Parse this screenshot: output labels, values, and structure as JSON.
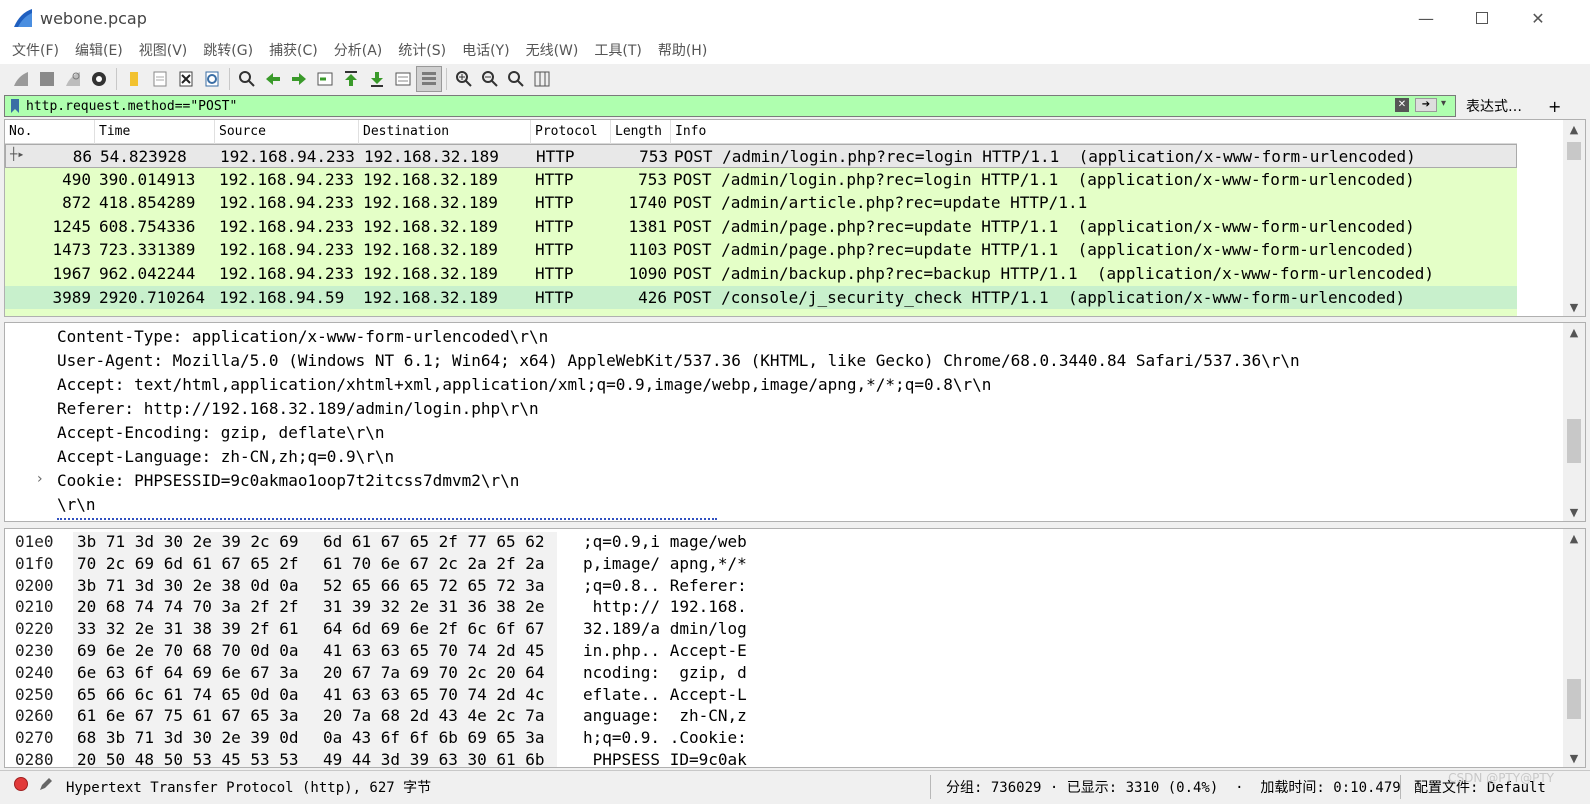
{
  "window": {
    "title": "webone.pcap"
  },
  "menu": [
    "文件(F)",
    "编辑(E)",
    "视图(V)",
    "跳转(G)",
    "捕获(C)",
    "分析(A)",
    "统计(S)",
    "电话(Y)",
    "无线(W)",
    "工具(T)",
    "帮助(H)"
  ],
  "filter": {
    "value": "http.request.method==\"POST\"",
    "expression_label": "表达式…",
    "add_label": "+"
  },
  "packet_list": {
    "columns": [
      "No.",
      "Time",
      "Source",
      "Destination",
      "Protocol",
      "Length",
      "Info"
    ],
    "rows": [
      {
        "no": "86",
        "time": "54.823928",
        "src": "192.168.94.233",
        "dst": "192.168.32.189",
        "proto": "HTTP",
        "len": "753",
        "info": "POST /admin/login.php?rec=login HTTP/1.1  (application/x-www-form-urlencoded)"
      },
      {
        "no": "490",
        "time": "390.014913",
        "src": "192.168.94.233",
        "dst": "192.168.32.189",
        "proto": "HTTP",
        "len": "753",
        "info": "POST /admin/login.php?rec=login HTTP/1.1  (application/x-www-form-urlencoded)"
      },
      {
        "no": "872",
        "time": "418.854289",
        "src": "192.168.94.233",
        "dst": "192.168.32.189",
        "proto": "HTTP",
        "len": "1740",
        "info": "POST /admin/article.php?rec=update HTTP/1.1"
      },
      {
        "no": "1245",
        "time": "608.754336",
        "src": "192.168.94.233",
        "dst": "192.168.32.189",
        "proto": "HTTP",
        "len": "1381",
        "info": "POST /admin/page.php?rec=update HTTP/1.1  (application/x-www-form-urlencoded)"
      },
      {
        "no": "1473",
        "time": "723.331389",
        "src": "192.168.94.233",
        "dst": "192.168.32.189",
        "proto": "HTTP",
        "len": "1103",
        "info": "POST /admin/page.php?rec=update HTTP/1.1  (application/x-www-form-urlencoded)"
      },
      {
        "no": "1967",
        "time": "962.042244",
        "src": "192.168.94.233",
        "dst": "192.168.32.189",
        "proto": "HTTP",
        "len": "1090",
        "info": "POST /admin/backup.php?rec=backup HTTP/1.1  (application/x-www-form-urlencoded)"
      },
      {
        "no": "3989",
        "time": "2920.710264",
        "src": "192.168.94.59",
        "dst": "192.168.32.189",
        "proto": "HTTP",
        "len": "426",
        "info": "POST /console/j_security_check HTTP/1.1  (application/x-www-form-urlencoded)"
      }
    ]
  },
  "details": [
    "Content-Type: application/x-www-form-urlencoded\\r\\n",
    "User-Agent: Mozilla/5.0 (Windows NT 6.1; Win64; x64) AppleWebKit/537.36 (KHTML, like Gecko) Chrome/68.0.3440.84 Safari/537.36\\r\\n",
    "Accept: text/html,application/xhtml+xml,application/xml;q=0.9,image/webp,image/apng,*/*;q=0.8\\r\\n",
    "Referer: http://192.168.32.189/admin/login.php\\r\\n",
    "Accept-Encoding: gzip, deflate\\r\\n",
    "Accept-Language: zh-CN,zh;q=0.9\\r\\n",
    "Cookie: PHPSESSID=9c0akmao1oop7t2itcss7dmvm2\\r\\n",
    "\\r\\n"
  ],
  "bytes": [
    {
      "off": "01e0",
      "h1": "3b 71 3d 30 2e 39 2c 69",
      "h2": "6d 61 67 65 2f 77 65 62",
      "a": ";q=0.9,i mage/web"
    },
    {
      "off": "01f0",
      "h1": "70 2c 69 6d 61 67 65 2f",
      "h2": "61 70 6e 67 2c 2a 2f 2a",
      "a": "p,image/ apng,*/*"
    },
    {
      "off": "0200",
      "h1": "3b 71 3d 30 2e 38 0d 0a",
      "h2": "52 65 66 65 72 65 72 3a",
      "a": ";q=0.8.. Referer:"
    },
    {
      "off": "0210",
      "h1": "20 68 74 74 70 3a 2f 2f",
      "h2": "31 39 32 2e 31 36 38 2e",
      "a": " http:// 192.168."
    },
    {
      "off": "0220",
      "h1": "33 32 2e 31 38 39 2f 61",
      "h2": "64 6d 69 6e 2f 6c 6f 67",
      "a": "32.189/a dmin/log"
    },
    {
      "off": "0230",
      "h1": "69 6e 2e 70 68 70 0d 0a",
      "h2": "41 63 63 65 70 74 2d 45",
      "a": "in.php.. Accept-E"
    },
    {
      "off": "0240",
      "h1": "6e 63 6f 64 69 6e 67 3a",
      "h2": "20 67 7a 69 70 2c 20 64",
      "a": "ncoding:  gzip, d"
    },
    {
      "off": "0250",
      "h1": "65 66 6c 61 74 65 0d 0a",
      "h2": "41 63 63 65 70 74 2d 4c",
      "a": "eflate.. Accept-L"
    },
    {
      "off": "0260",
      "h1": "61 6e 67 75 61 67 65 3a",
      "h2": "20 7a 68 2d 43 4e 2c 7a",
      "a": "anguage:  zh-CN,z"
    },
    {
      "off": "0270",
      "h1": "68 3b 71 3d 30 2e 39 0d",
      "h2": "0a 43 6f 6f 6b 69 65 3a",
      "a": "h;q=0.9. .Cookie:"
    },
    {
      "off": "0280",
      "h1": "20 50 48 50 53 45 53 53",
      "h2": "49 44 3d 39 63 30 61 6b",
      "a": " PHPSESS ID=9c0ak"
    }
  ],
  "status": {
    "protocol": "Hypertext Transfer Protocol (http), 627 字节",
    "packets": "分组: 736029 · 已显示: 3310 (0.4%)  ·  加载时间: 0:10.479",
    "profile": "配置文件: Default",
    "watermark": "CSDN @PTY@PTY"
  }
}
